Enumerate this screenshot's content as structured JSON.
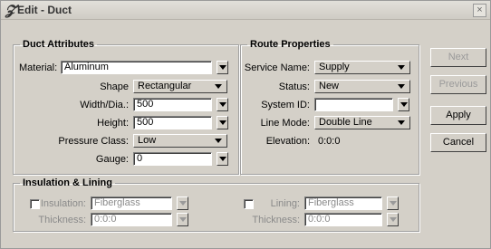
{
  "window": {
    "title": "Edit - Duct",
    "close_glyph": "×"
  },
  "duct_attributes": {
    "legend": "Duct Attributes",
    "material_label": "Material:",
    "material_value": "Aluminum",
    "shape_label": "Shape",
    "shape_value": "Rectangular",
    "width_label": "Width/Dia.:",
    "width_value": "500",
    "height_label": "Height:",
    "height_value": "500",
    "pressure_label": "Pressure Class:",
    "pressure_value": "Low",
    "gauge_label": "Gauge:",
    "gauge_value": "0"
  },
  "route_properties": {
    "legend": "Route Properties",
    "service_label": "Service Name:",
    "service_value": "Supply",
    "status_label": "Status:",
    "status_value": "New",
    "system_label": "System ID:",
    "system_value": "",
    "line_mode_label": "Line Mode:",
    "line_mode_value": "Double Line",
    "elevation_label": "Elevation:",
    "elevation_value": "0:0:0"
  },
  "insulation_lining": {
    "legend": "Insulation & Lining",
    "insulation_label": "Insulation:",
    "insulation_value": "Fiberglass",
    "ins_thickness_label": "Thickness:",
    "ins_thickness_value": "0:0:0",
    "lining_label": "Lining:",
    "lining_value": "Fiberglass",
    "lin_thickness_label": "Thickness:",
    "lin_thickness_value": "0:0:0"
  },
  "buttons": {
    "next": "Next",
    "previous": "Previous",
    "apply": "Apply",
    "cancel": "Cancel"
  }
}
